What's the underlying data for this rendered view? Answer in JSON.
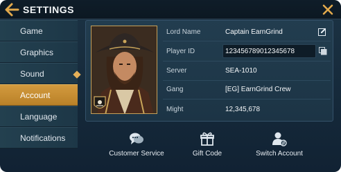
{
  "header": {
    "title": "SETTINGS"
  },
  "sidebar": {
    "items": [
      {
        "label": "Game"
      },
      {
        "label": "Graphics"
      },
      {
        "label": "Sound"
      },
      {
        "label": "Account"
      },
      {
        "label": "Language"
      },
      {
        "label": "Notifications"
      }
    ],
    "active": "Account"
  },
  "profile": {
    "lord_name_label": "Lord Name",
    "lord_name": "Captain EarnGrind",
    "player_id_label": "Player ID",
    "player_id": "123456789012345678",
    "server_label": "Server",
    "server": "SEA-1010",
    "gang_label": "Gang",
    "gang": "[EG] EarnGrind Crew",
    "might_label": "Might",
    "might": "12,345,678"
  },
  "actions": [
    {
      "label": "Customer Service",
      "icon": "chat-bubbles-icon"
    },
    {
      "label": "Gift Code",
      "icon": "gift-icon"
    },
    {
      "label": "Switch Account",
      "icon": "switch-user-icon"
    }
  ],
  "colors": {
    "accent": "#d39a3e",
    "panel": "#1c3344",
    "text": "#e6edf3"
  }
}
